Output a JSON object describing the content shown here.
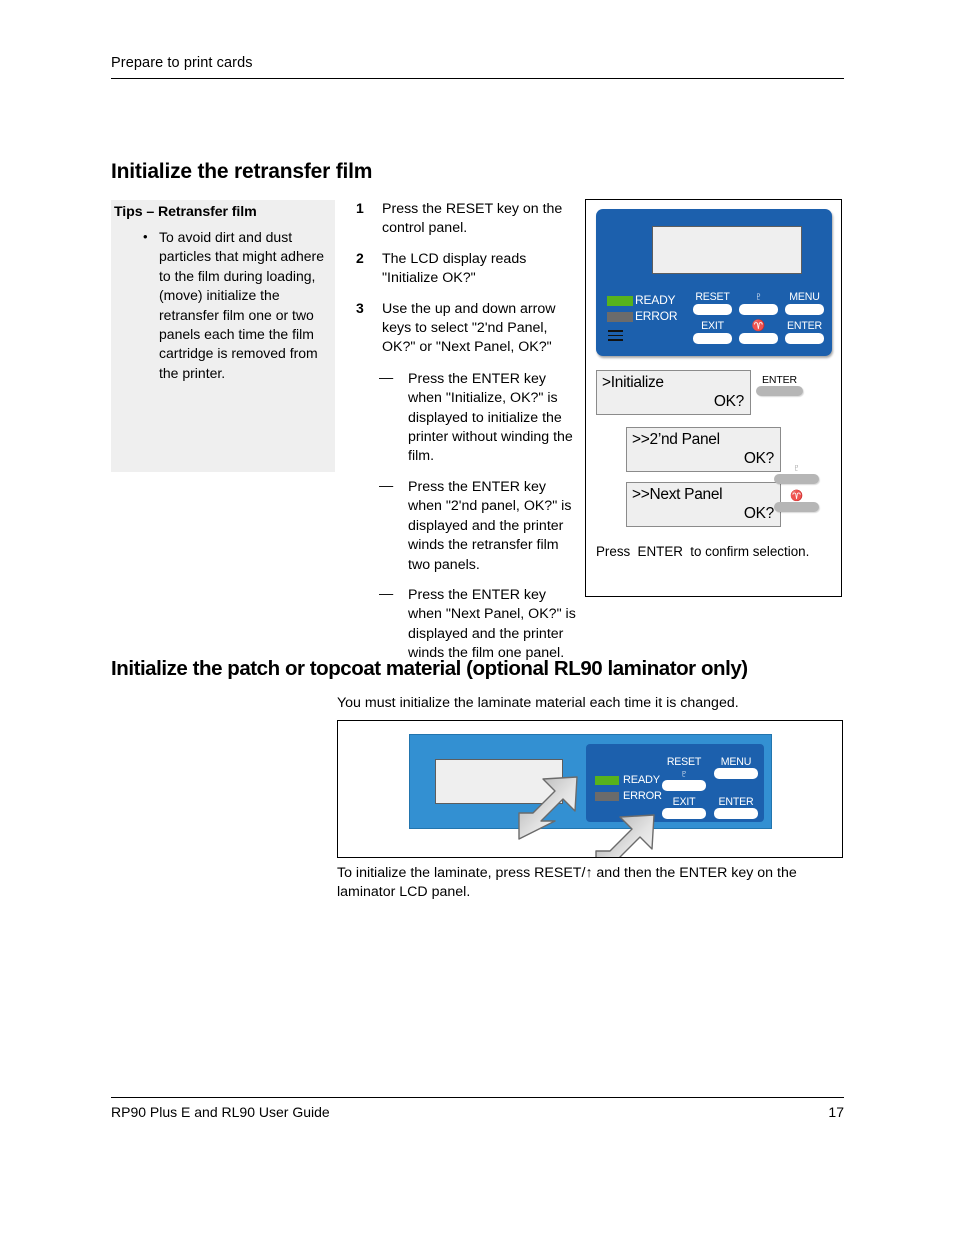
{
  "header": {
    "running_head": "Prepare to print cards"
  },
  "section1": {
    "heading": "Initialize the retransfer film",
    "tips": {
      "title": "Tips – Retransfer film",
      "bullet_char": "•",
      "items": [
        "To avoid dirt and dust particles that might adhere to the film during loading, (move) initialize the retransfer film one or two panels each time the film cartridge is removed from the printer."
      ]
    },
    "steps": [
      {
        "num": "1",
        "text": "Press the RESET key on the control panel."
      },
      {
        "num": "2",
        "text": "The LCD display reads \"Initialize OK?\""
      },
      {
        "num": "3",
        "text": "Use the up and down arrow keys to select \"2'nd Panel, OK?\" or \"Next Panel, OK?\""
      }
    ],
    "substeps": [
      {
        "dash": "—",
        "text": "Press the ENTER key when \"Initialize, OK?\" is displayed to initialize the printer without winding the film."
      },
      {
        "dash": "—",
        "text": "Press the ENTER key when \"2'nd panel, OK?\" is displayed and the printer winds the retransfer film two panels."
      },
      {
        "dash": "—",
        "text": "Press the ENTER key when \"Next Panel, OK?\" is displayed and the printer winds the film one panel."
      }
    ],
    "figure": {
      "control_panel": {
        "leds": [
          {
            "name": "READY",
            "color": "#57b21c"
          },
          {
            "name": "ERROR",
            "color": "#6b6b6b"
          }
        ],
        "keys_row1": [
          {
            "label": "RESET"
          },
          {
            "label": "♇"
          },
          {
            "label": "MENU"
          }
        ],
        "keys_row2": [
          {
            "label": "EXIT"
          },
          {
            "label": "♈"
          },
          {
            "label": "ENTER"
          }
        ],
        "panel_color": "#1c60ad"
      },
      "messages": [
        {
          "line1": ">Initialize",
          "line2": "OK?"
        },
        {
          "line1": ">>2’nd Panel",
          "line2": "OK?"
        },
        {
          "line1": ">>Next Panel",
          "line2": "OK?"
        }
      ],
      "enter_key_label": "ENTER",
      "up_arrow_glyph": "♇",
      "down_arrow_glyph": "♈",
      "press_prefix": "Press",
      "press_suffix": "to confirm selection."
    }
  },
  "section2": {
    "heading": "Initialize the patch or topcoat material (optional RL90 laminator only)",
    "intro": "You must initialize the laminate material each time it is changed.",
    "figure": {
      "leds": [
        {
          "name": "READY",
          "color": "#57b21c"
        },
        {
          "name": "ERROR",
          "color": "#6b6b6b"
        }
      ],
      "keys_row1": [
        {
          "label": "RESET ♇"
        },
        {
          "label": "MENU"
        }
      ],
      "keys_row2": [
        {
          "label": "EXIT"
        },
        {
          "label": "ENTER"
        }
      ],
      "body_color": "#3390d2",
      "panel_color": "#1c60ad"
    },
    "caption": "To initialize the laminate, press RESET/↑ and then the ENTER key on the laminator LCD panel."
  },
  "footer": {
    "guide_title": "RP90 Plus E and RL90 User Guide",
    "page_number": "17"
  }
}
